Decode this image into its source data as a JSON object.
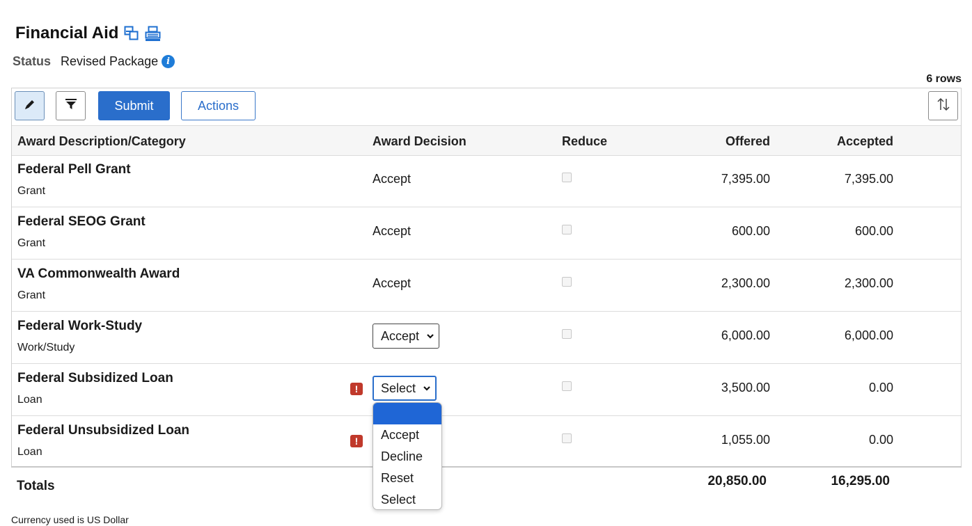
{
  "page": {
    "title": "Financial Aid",
    "status_label": "Status",
    "status_value": "Revised Package",
    "row_count": "6 rows"
  },
  "toolbar": {
    "submit_label": "Submit",
    "actions_label": "Actions"
  },
  "columns": {
    "description": "Award Description/Category",
    "decision": "Award Decision",
    "reduce": "Reduce",
    "offered": "Offered",
    "accepted": "Accepted"
  },
  "rows": [
    {
      "name": "Federal Pell Grant",
      "category": "Grant",
      "decision": "Accept",
      "offered": "7,395.00",
      "accepted": "7,395.00"
    },
    {
      "name": "Federal SEOG Grant",
      "category": "Grant",
      "decision": "Accept",
      "offered": "600.00",
      "accepted": "600.00"
    },
    {
      "name": "VA Commonwealth Award",
      "category": "Grant",
      "decision": "Accept",
      "offered": "2,300.00",
      "accepted": "2,300.00"
    },
    {
      "name": "Federal Work-Study",
      "category": "Work/Study",
      "decision": "Accept",
      "offered": "6,000.00",
      "accepted": "6,000.00"
    },
    {
      "name": "Federal Subsidized Loan",
      "category": "Loan",
      "decision": "Select",
      "offered": "3,500.00",
      "accepted": "0.00"
    },
    {
      "name": "Federal Unsubsidized Loan",
      "category": "Loan",
      "decision": "",
      "offered": "1,055.00",
      "accepted": "0.00"
    }
  ],
  "dropdown": {
    "options": [
      "",
      "Accept",
      "Decline",
      "Reset",
      "Select"
    ]
  },
  "totals": {
    "label": "Totals",
    "offered": "20,850.00",
    "accepted": "16,295.00"
  },
  "footer": {
    "currency_note": "Currency used is US Dollar"
  },
  "colors": {
    "primary": "#2a6ecb",
    "warning": "#c0392b",
    "info": "#1e7cd8",
    "dropdown_highlight": "#1f66d6"
  },
  "icons": {
    "title": [
      "new-window-icon",
      "print-icon"
    ],
    "status": "info-icon",
    "toolbar": [
      "pencil-icon",
      "filter-icon",
      "sort-icon"
    ],
    "row_warning": "warning-icon",
    "select_arrow": "chevron-down-icon"
  }
}
